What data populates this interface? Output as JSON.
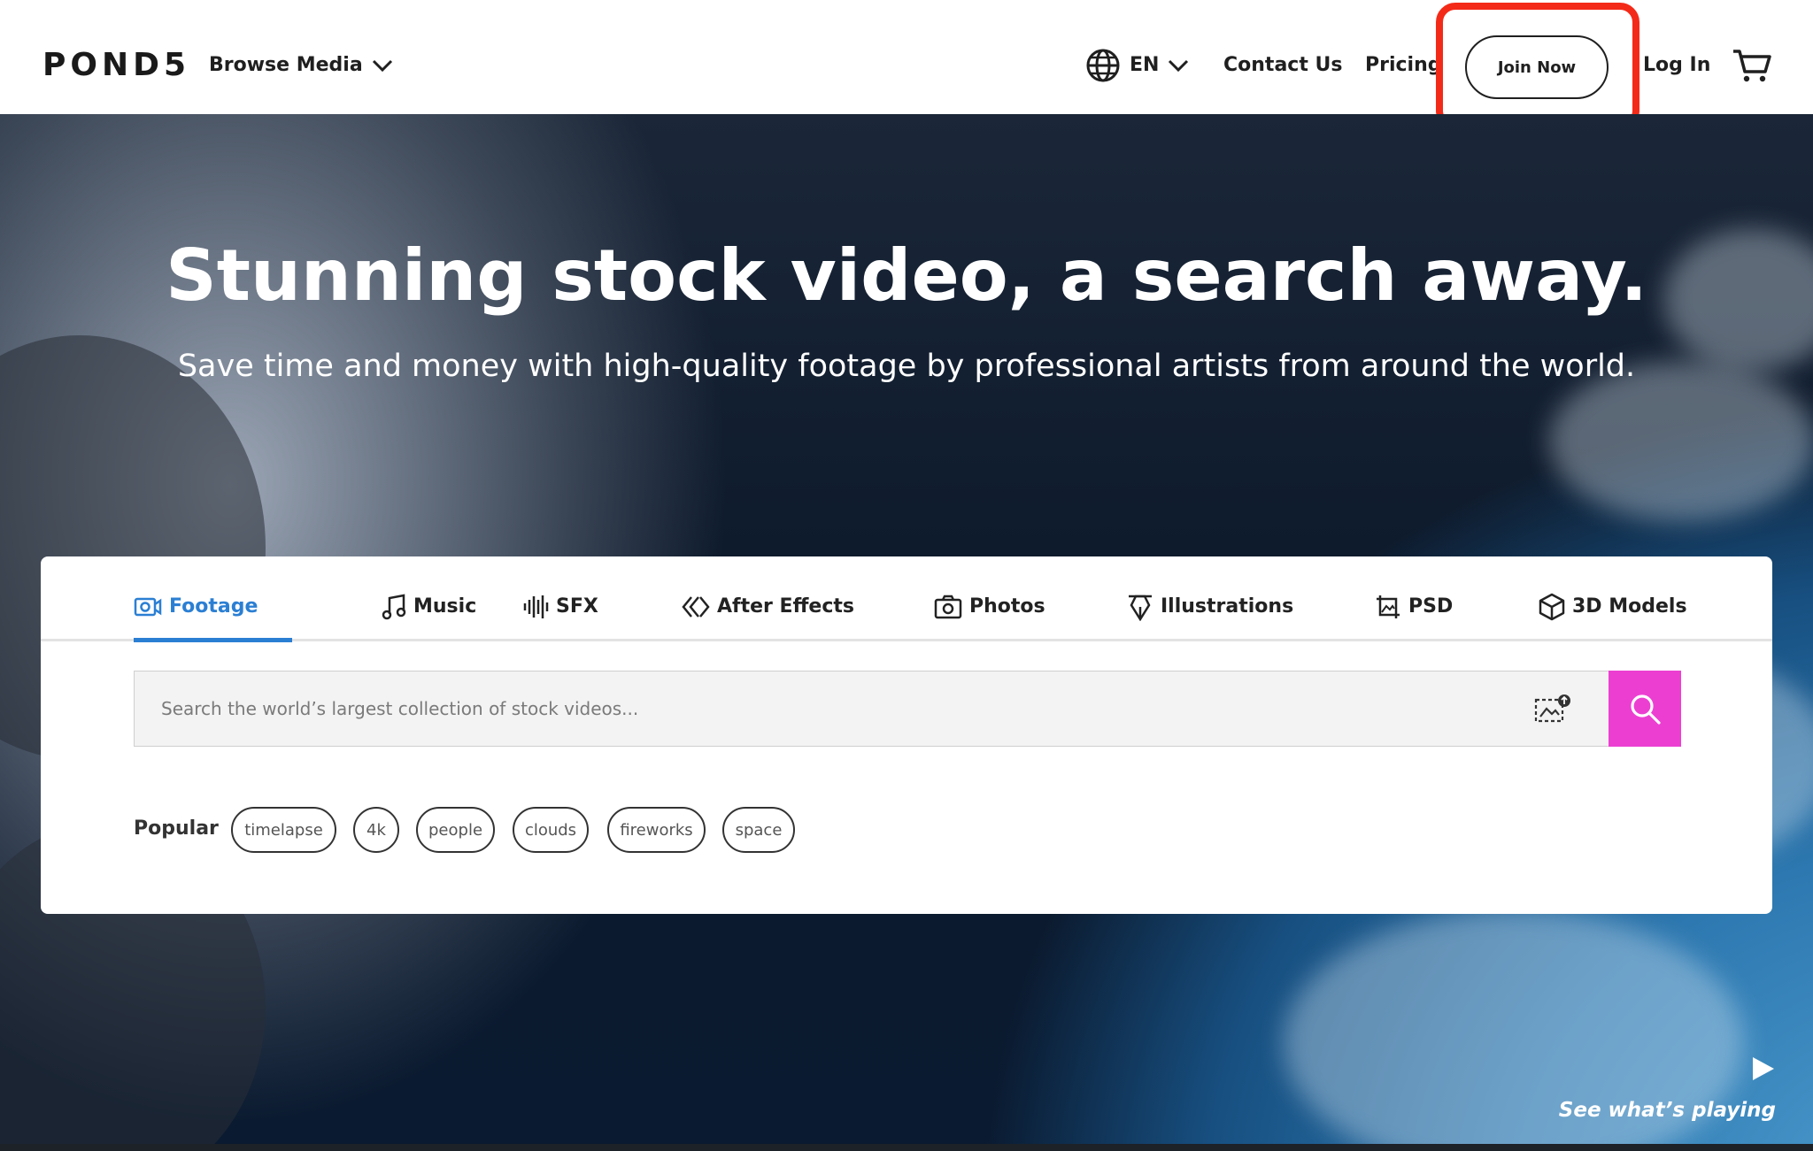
{
  "header": {
    "logo": "POND5",
    "browse_media": "Browse Media",
    "language": "EN",
    "contact": "Contact Us",
    "pricing": "Pricing",
    "join": "Join Now",
    "login": "Log In"
  },
  "hero": {
    "title": "Stunning stock video, a search away.",
    "subtitle": "Save time and money with high-quality footage by professional artists from around the world."
  },
  "tabs": [
    {
      "label": "Footage",
      "icon": "video-camera-icon",
      "active": true
    },
    {
      "label": "Music",
      "icon": "music-note-icon"
    },
    {
      "label": "SFX",
      "icon": "sound-wave-icon"
    },
    {
      "label": "After Effects",
      "icon": "after-effects-icon"
    },
    {
      "label": "Photos",
      "icon": "camera-icon"
    },
    {
      "label": "Illustrations",
      "icon": "pen-nib-icon"
    },
    {
      "label": "PSD",
      "icon": "image-crop-icon"
    },
    {
      "label": "3D Models",
      "icon": "cube-icon"
    }
  ],
  "search": {
    "placeholder": "Search the world’s largest collection of stock videos..."
  },
  "popular": {
    "label": "Popular",
    "chips": [
      "timelapse",
      "4k",
      "people",
      "clouds",
      "fireworks",
      "space"
    ]
  },
  "footer": {
    "see_playing": "See what’s playing"
  },
  "colors": {
    "accent_blue": "#2b7fd3",
    "search_button": "#ec3fd2",
    "annotation_red": "#f42a18"
  }
}
